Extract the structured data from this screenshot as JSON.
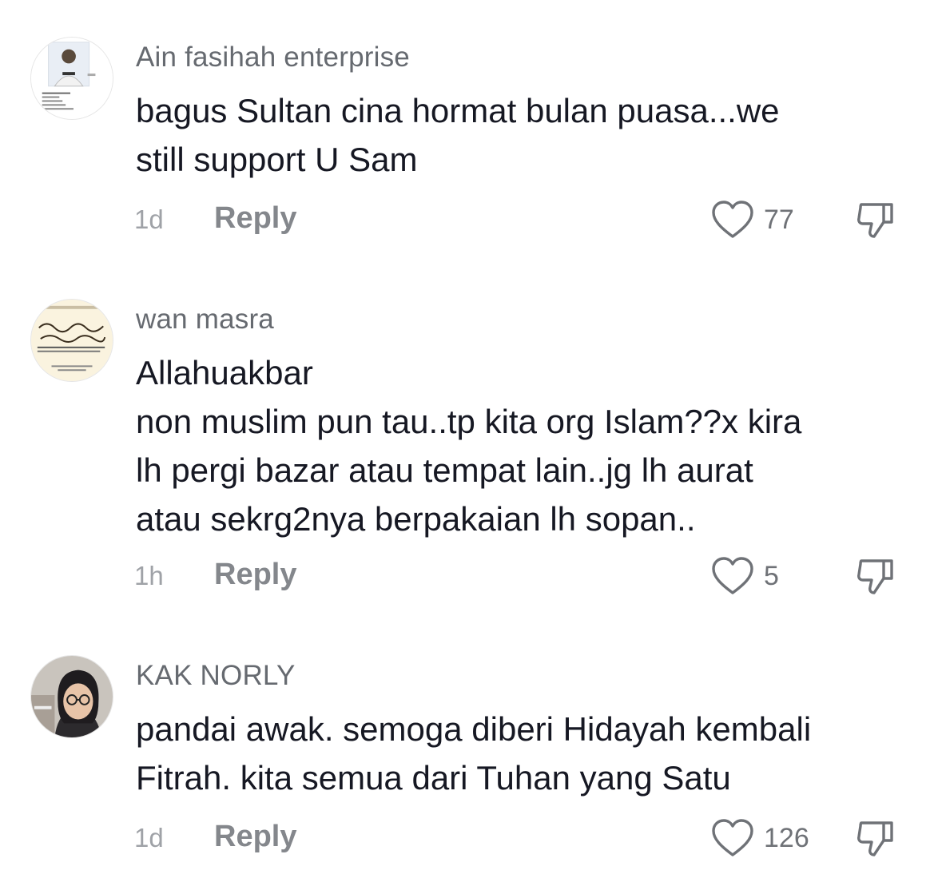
{
  "comments": [
    {
      "username": "Ain fasihah enterprise",
      "text": "bagus Sultan cina hormat bulan puasa...we\nstill support U Sam",
      "time": "1d",
      "reply_label": "Reply",
      "likes": "77",
      "avatar_icon": "id-card-photo"
    },
    {
      "username": "wan masra",
      "text": "Allahuakbar\nnon muslim pun tau..tp kita org Islam??x kira\nlh pergi bazar atau tempat lain..jg lh aurat\natau sekrg2nya berpakaian lh sopan..",
      "time": "1h",
      "reply_label": "Reply",
      "likes": "5",
      "avatar_icon": "arabic-calligraphy-card"
    },
    {
      "username": "KAK NORLY",
      "text": "pandai awak. semoga diberi Hidayah kembali\nFitrah. kita semua dari Tuhan yang Satu",
      "time": "1d",
      "reply_label": "Reply",
      "likes": "126",
      "avatar_icon": "profile-photo"
    }
  ],
  "icons": {
    "like": "heart-outline-icon",
    "dislike": "thumbs-down-icon"
  },
  "colors": {
    "text": "#161823",
    "username": "#666a70",
    "meta": "#9fa2a7",
    "icon": "#6f7277"
  }
}
